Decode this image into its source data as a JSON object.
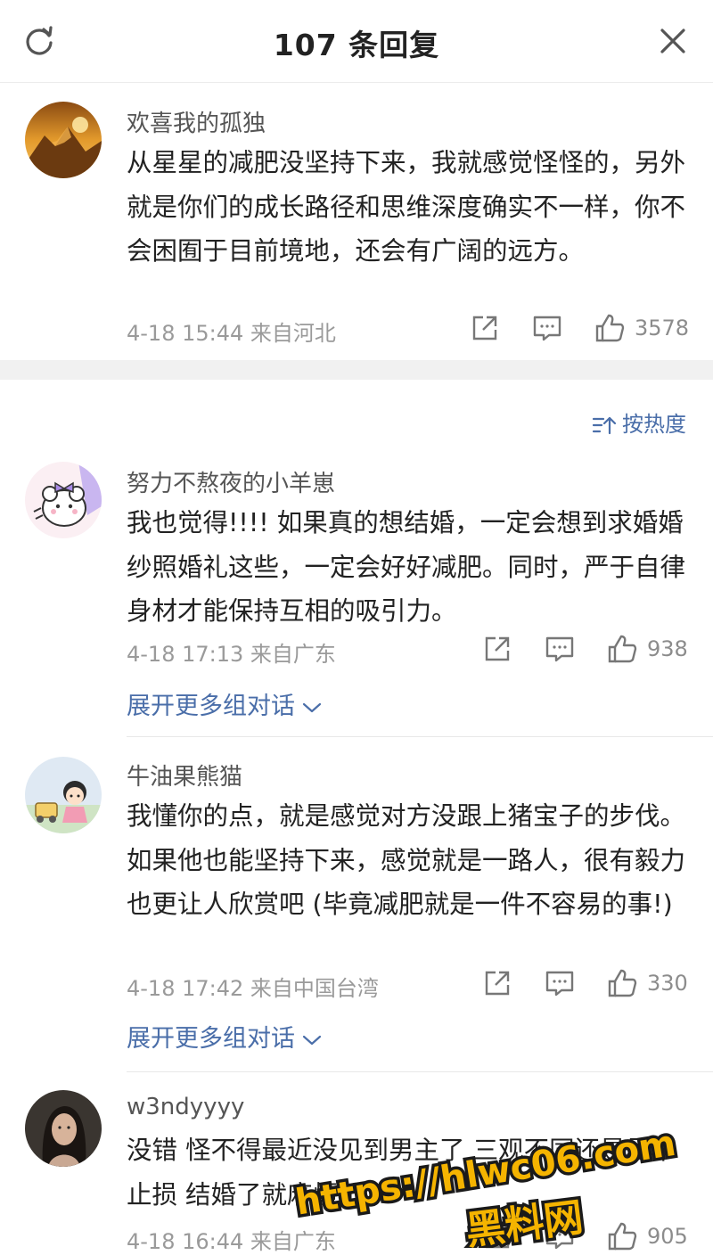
{
  "header": {
    "title": "107 条回复"
  },
  "op": {
    "username": "欢喜我的孤独",
    "content": "从星星的减肥没坚持下来，我就感觉怪怪的，另外就是你们的成长路径和思维深度确实不一样，你不会困囿于目前境地，还会有广阔的远方。",
    "meta": "4-18 15:44  来自河北",
    "likes": "3578"
  },
  "sort": {
    "label": "按热度"
  },
  "comments": [
    {
      "username": "努力不熬夜的小羊崽",
      "content": "我也觉得!!!! 如果真的想结婚，一定会想到求婚婚纱照婚礼这些，一定会好好减肥。同时，严于自律身材才能保持互相的吸引力。",
      "meta": "4-18 17:13  来自广东",
      "likes": "938",
      "expand": "展开更多组对话"
    },
    {
      "username": "牛油果熊猫",
      "content": "我懂你的点，就是感觉对方没跟上猪宝子的步伐。如果他也能坚持下来，感觉就是一路人，很有毅力也更让人欣赏吧 (毕竟减肥就是一件不容易的事!)",
      "meta": "4-18 17:42  来自中国台湾",
      "likes": "330",
      "expand": "展开更多组对话"
    },
    {
      "username": "w3ndyyyy",
      "content": "没错 怪不得最近没见到男主了 三观不同还是尽早止损 结婚了就麻烦了.",
      "meta": "4-18 16:44  来自广东",
      "likes": "905"
    }
  ],
  "watermark": {
    "url": "https://hlwc06.com",
    "name": "黑料网"
  },
  "colors": {
    "link": "#4a6ea9",
    "meta": "#9a9a9a",
    "watermark_fill": "#f5b400"
  }
}
